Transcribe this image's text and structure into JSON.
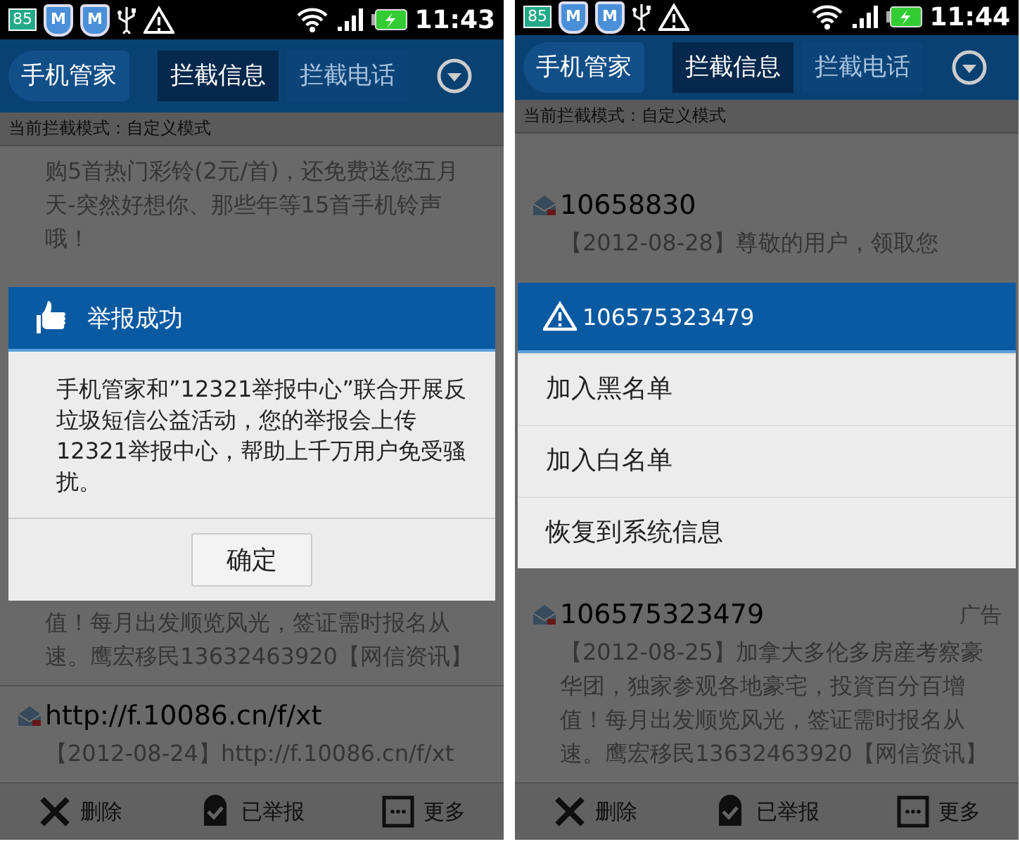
{
  "phones": [
    {
      "status_bar": {
        "battery_badge": "85",
        "app_badges": [
          "M",
          "M"
        ],
        "time": "11:43"
      },
      "header": {
        "back": "手机管家",
        "tabs": [
          {
            "label": "拦截信息",
            "selected": true
          },
          {
            "label": "拦截电话",
            "selected": false
          }
        ]
      },
      "mode": "当前拦截模式：自定义模式",
      "content": [
        {
          "kind": "fragment",
          "body": "购5首热门彩铃(2元/首)，还免费送您五月天-突然好想你、那些年等15首手机铃声哦！"
        },
        {
          "kind": "alert",
          "title": "举报成功",
          "body": "手机管家和”12321举报中心”联合开展反垃圾短信公益活动，您的举报会上传12321举报中心，帮助上千万用户免受骚扰。",
          "button": "确定"
        },
        {
          "kind": "fragment",
          "body": "值！每月出发顺览风光，签证需时报名从速。鹰宏移民13632463920【网信资讯】"
        },
        {
          "kind": "message",
          "sender": "http://f.10086.cn/f/xt",
          "body": "【2012-08-24】http://f.10086.cn/f/xt"
        }
      ],
      "toolbar": [
        {
          "kind": "delete",
          "label": "删除"
        },
        {
          "kind": "reported",
          "label": "已举报"
        },
        {
          "kind": "more",
          "label": "更多"
        }
      ]
    },
    {
      "status_bar": {
        "battery_badge": "85",
        "app_badges": [
          "M",
          "M"
        ],
        "time": "11:44"
      },
      "header": {
        "back": "手机管家",
        "tabs": [
          {
            "label": "拦截信息",
            "selected": true
          },
          {
            "label": "拦截电话",
            "selected": false
          }
        ]
      },
      "mode": "当前拦截模式：自定义模式",
      "content": [
        {
          "kind": "message",
          "sender": "10658830",
          "body": "【2012-08-28】尊敬的用户，领取您"
        },
        {
          "kind": "menu",
          "title": "106575323479",
          "items": [
            "加入黑名单",
            "加入白名单",
            "恢复到系统信息"
          ]
        },
        {
          "kind": "message",
          "sender": "106575323479",
          "tag": "广告",
          "body": "【2012-08-25】加拿大多伦多房産考察豪华团，独家参观各地豪宅，投資百分百增值！每月出发顺览风光，签证需时报名从速。鹰宏移民13632463920【网信资讯】"
        }
      ],
      "toolbar": [
        {
          "kind": "delete",
          "label": "删除"
        },
        {
          "kind": "reported",
          "label": "已举报"
        },
        {
          "kind": "more",
          "label": "更多"
        }
      ]
    }
  ]
}
